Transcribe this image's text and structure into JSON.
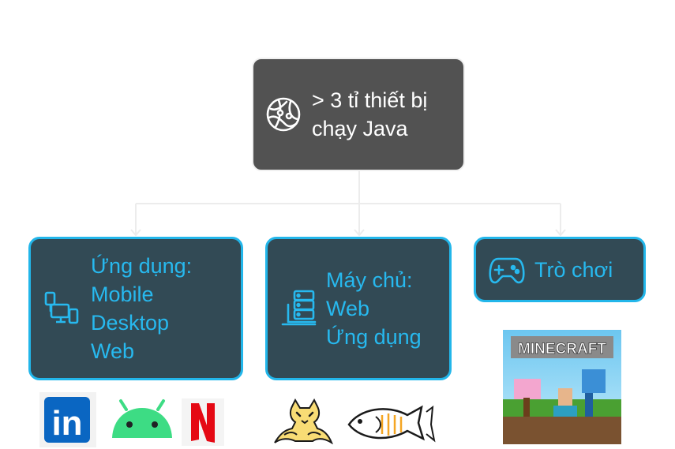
{
  "root": {
    "icon": "globe-network-icon",
    "lines": [
      "> 3 tỉ thiết bị",
      "chạy Java"
    ]
  },
  "children": [
    {
      "icon": "devices-icon",
      "lines": [
        "Ứng dụng:",
        "Mobile",
        "Desktop",
        "Web"
      ],
      "logos": [
        "linkedin-logo",
        "android-logo",
        "netflix-logo"
      ]
    },
    {
      "icon": "server-icon",
      "lines": [
        "Máy chủ:",
        "Web",
        "Ứng dụng"
      ],
      "logos": [
        "tomcat-logo",
        "glassfish-logo"
      ]
    },
    {
      "icon": "gamepad-icon",
      "lines": [
        "Trò chơi"
      ],
      "logos": [
        "minecraft-cover"
      ]
    }
  ],
  "logo_text": {
    "linkedin": "in",
    "netflix": "N",
    "minecraft": "MINECRAFT"
  },
  "colors": {
    "root_fill": "#525252",
    "child_fill": "#324a55",
    "child_text": "#27b9ef",
    "child_border": "#22b6ea",
    "connector": "#ececec"
  }
}
